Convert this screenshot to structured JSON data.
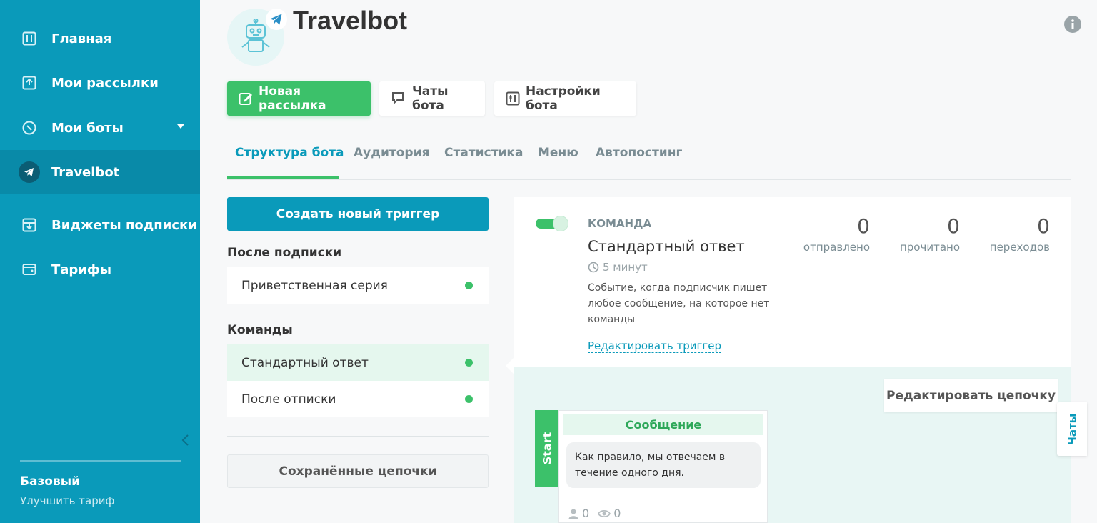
{
  "sidebar": {
    "items": [
      {
        "label": "Главная",
        "icon": "home-icon"
      },
      {
        "label": "Мои рассылки",
        "icon": "mailings-icon"
      },
      {
        "label": "Мои боты",
        "icon": "bots-icon"
      },
      {
        "label": "Travelbot",
        "icon": "telegram-icon"
      },
      {
        "label": "Виджеты подписки",
        "icon": "widgets-icon"
      },
      {
        "label": "Тарифы",
        "icon": "wallet-icon"
      }
    ],
    "plan": {
      "name": "Базовый",
      "upgrade": "Улучшить тариф"
    }
  },
  "header": {
    "title": "Travelbot"
  },
  "actions": {
    "new_mailing": "Новая рассылка",
    "bot_chats": "Чаты бота",
    "bot_settings": "Настройки бота"
  },
  "tabs": [
    "Структура бота",
    "Аудитория",
    "Статистика",
    "Меню",
    "Автопостинг"
  ],
  "left": {
    "create_trigger": "Создать новый триггер",
    "after_subscribe_title": "После подписки",
    "welcome_series": "Приветственная серия",
    "commands_title": "Команды",
    "standard_reply": "Стандартный ответ",
    "after_unsubscribe": "После отписки",
    "saved_chains": "Сохранённые цепочки"
  },
  "trigger": {
    "kind": "КОМАНДА",
    "name": "Стандартный ответ",
    "delay": "5 минут",
    "description": "Событие, когда подписчик пишет любое сообщение, на которое нет команды",
    "edit": "Редактировать триггер",
    "stats": [
      {
        "value": "0",
        "label": "отправлено"
      },
      {
        "value": "0",
        "label": "прочитано"
      },
      {
        "value": "0",
        "label": "переходов"
      }
    ]
  },
  "chain": {
    "edit_chain": "Редактировать цепочку",
    "chats_tab": "Чаты",
    "start": "Start",
    "message_title": "Сообщение",
    "message_text": "Как правило, мы отвечаем в течение одного дня.",
    "subscribers": "0",
    "views": "0"
  },
  "colors": {
    "sidebar": "#0a9aba",
    "accent_green": "#3cc16a",
    "primary_blue": "#0a9aba"
  }
}
